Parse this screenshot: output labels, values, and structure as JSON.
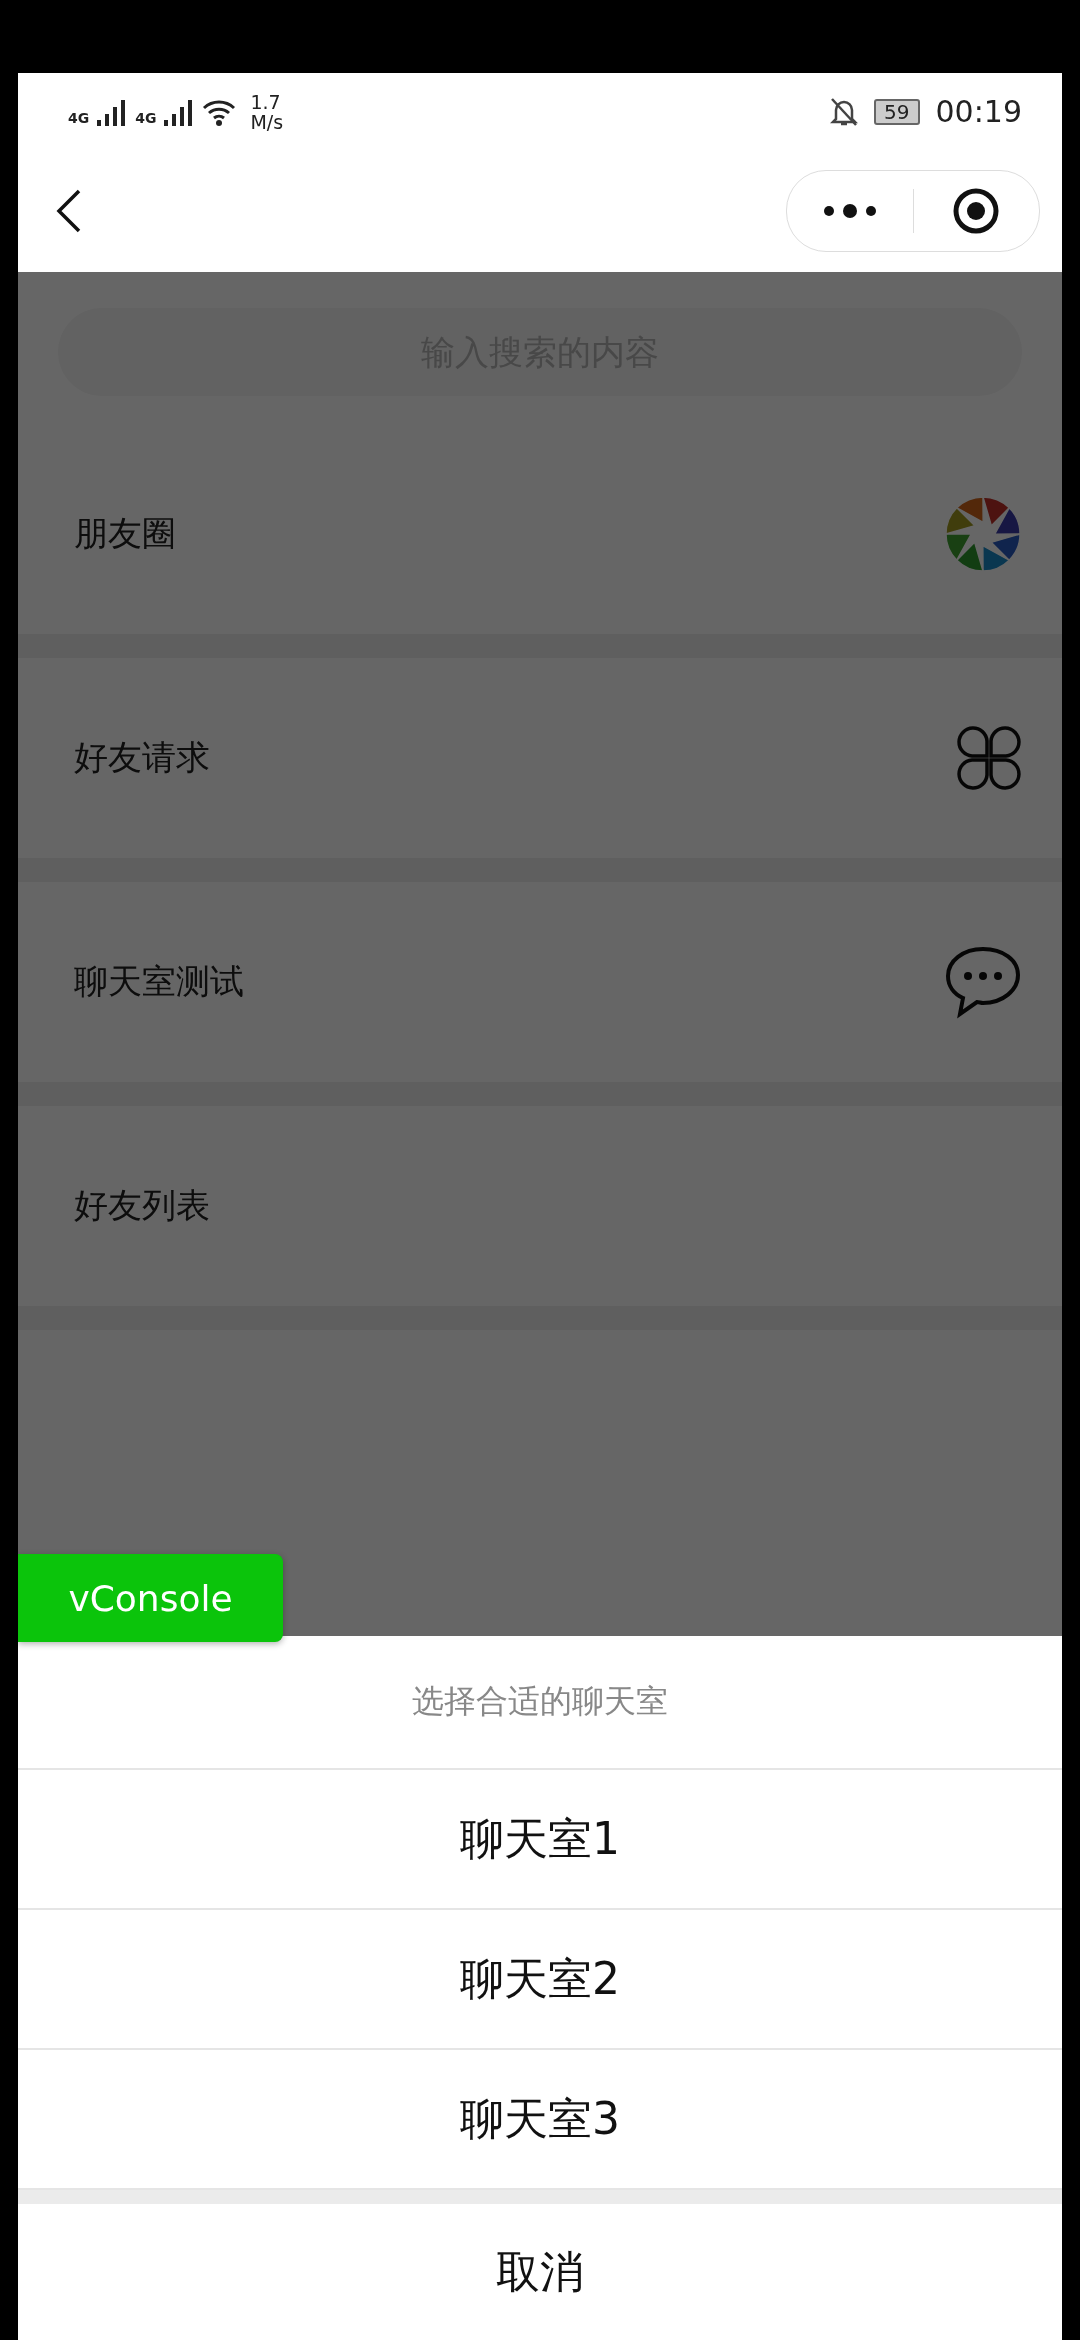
{
  "status_bar": {
    "network_1": "4G",
    "network_2": "4G",
    "speed_value": "1.7",
    "speed_unit": "M/s",
    "battery": "59",
    "time": "00:19"
  },
  "search": {
    "placeholder": "输入搜索的内容"
  },
  "menu_items": [
    {
      "label": "朋友圈",
      "kind": "aperture"
    },
    {
      "label": "好友请求",
      "kind": "clover"
    },
    {
      "label": "聊天室测试",
      "kind": "chat"
    },
    {
      "label": "好友列表",
      "kind": "plain"
    }
  ],
  "debug_button": {
    "label": "vConsole"
  },
  "action_sheet": {
    "title": "选择合适的聊天室",
    "options": [
      "聊天室1",
      "聊天室2",
      "聊天室3"
    ],
    "cancel": "取消"
  }
}
